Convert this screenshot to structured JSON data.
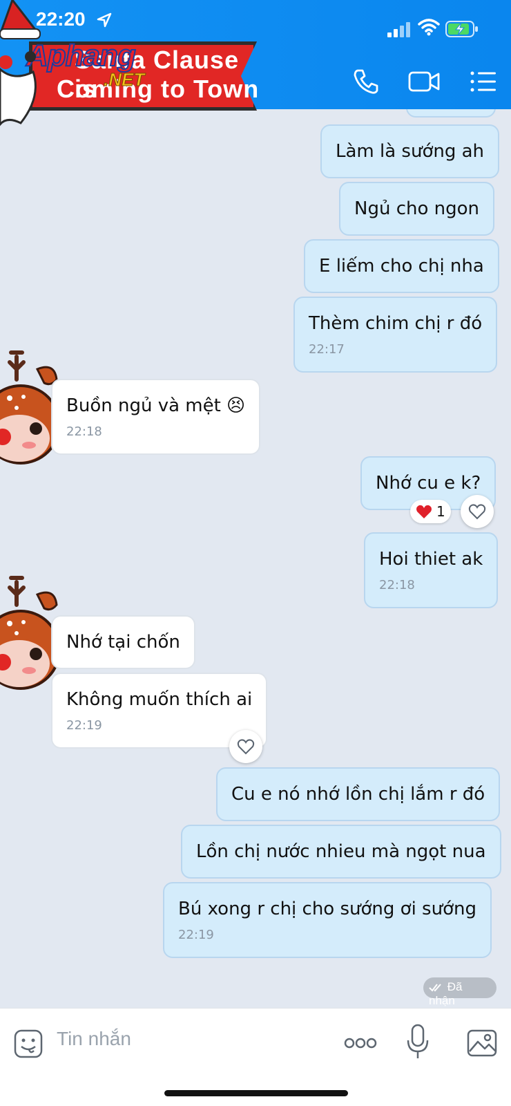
{
  "status_bar": {
    "time": "22:20"
  },
  "header": {
    "call_icon": "phone-icon",
    "video_icon": "video-camera-icon",
    "menu_icon": "list-menu-icon",
    "banner_line1": "Santa Clause is",
    "banner_line2": "Coming to Town",
    "watermark_main": "Aphang",
    "watermark_sub": ".NET"
  },
  "messages": [
    {
      "side": "out",
      "text": "Làm là sướng ah"
    },
    {
      "side": "out",
      "text": "Ngủ cho ngon"
    },
    {
      "side": "out",
      "text": "E liếm cho chị nha"
    },
    {
      "side": "out",
      "text": "Thèm chim chị r đó",
      "time": "22:17"
    },
    {
      "side": "in",
      "text": "Buồn ngủ và mệt 😣",
      "time": "22:18"
    },
    {
      "side": "out",
      "text": "Nhớ cu e k?",
      "reaction": "1"
    },
    {
      "side": "out",
      "text": "Hoi thiet ak",
      "time": "22:18"
    },
    {
      "side": "in",
      "text": "Nhớ tại chốn"
    },
    {
      "side": "in",
      "text": "Không muốn thích ai",
      "time": "22:19"
    },
    {
      "side": "out",
      "text": "Cu e nó nhớ lồn chị lắm r đó"
    },
    {
      "side": "out",
      "text": "Lồn chị nước nhieu mà ngọt nua"
    },
    {
      "side": "out",
      "text": "Bú xong r chị cho sướng ơi sướng",
      "time": "22:19"
    }
  ],
  "received_label": "Đã nhận",
  "input": {
    "placeholder": "Tin nhắn"
  },
  "colors": {
    "header": "#0a86ee",
    "outgoing_bubble": "#d4ecfb",
    "incoming_bubble": "#ffffff",
    "chat_bg": "#e2e8f1"
  }
}
